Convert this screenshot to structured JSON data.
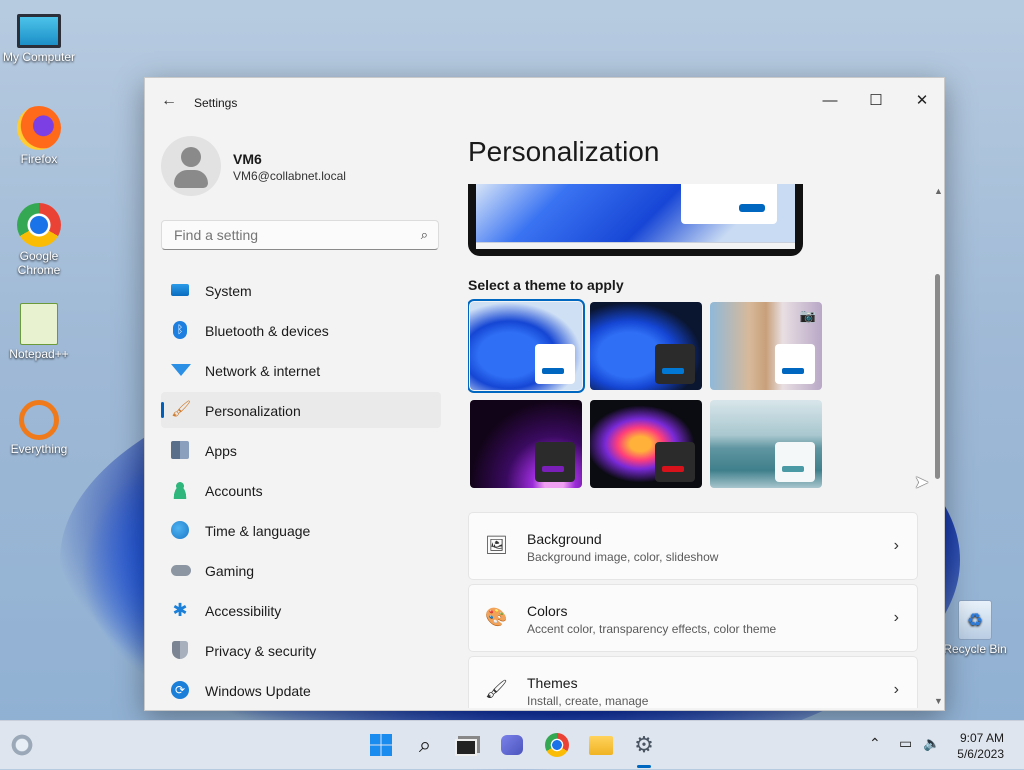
{
  "desktop": {
    "icons": [
      {
        "label": "My Computer"
      },
      {
        "label": "Firefox"
      },
      {
        "label": "Google Chrome"
      },
      {
        "label": "Notepad++"
      },
      {
        "label": "Everything"
      },
      {
        "label": "Recycle Bin"
      }
    ]
  },
  "window": {
    "title": "Settings",
    "controls": {
      "minimize": "—",
      "maximize": "☐",
      "close": "✕"
    },
    "back_icon": "←"
  },
  "profile": {
    "name": "VM6",
    "email": "VM6@collabnet.local"
  },
  "search": {
    "placeholder": "Find a setting"
  },
  "nav": {
    "items": [
      {
        "label": "System",
        "icon": "monitor-icon",
        "active": false
      },
      {
        "label": "Bluetooth & devices",
        "icon": "bluetooth-icon",
        "active": false
      },
      {
        "label": "Network & internet",
        "icon": "wifi-icon",
        "active": false
      },
      {
        "label": "Personalization",
        "icon": "paintbrush-icon",
        "active": true
      },
      {
        "label": "Apps",
        "icon": "apps-icon",
        "active": false
      },
      {
        "label": "Accounts",
        "icon": "person-icon",
        "active": false
      },
      {
        "label": "Time & language",
        "icon": "globe-clock-icon",
        "active": false
      },
      {
        "label": "Gaming",
        "icon": "gamepad-icon",
        "active": false
      },
      {
        "label": "Accessibility",
        "icon": "accessibility-icon",
        "active": false
      },
      {
        "label": "Privacy & security",
        "icon": "shield-icon",
        "active": false
      },
      {
        "label": "Windows Update",
        "icon": "update-icon",
        "active": false
      }
    ]
  },
  "main": {
    "title": "Personalization",
    "themes_label": "Select a theme to apply",
    "themes": [
      {
        "name": "windows-light",
        "selected": true
      },
      {
        "name": "windows-dark",
        "selected": false
      },
      {
        "name": "windows-spotlight",
        "selected": false
      },
      {
        "name": "glow",
        "selected": false
      },
      {
        "name": "captured-motion",
        "selected": false
      },
      {
        "name": "flow",
        "selected": false
      }
    ],
    "cards": [
      {
        "title": "Background",
        "subtitle": "Background image, color, slideshow",
        "icon": "image-icon"
      },
      {
        "title": "Colors",
        "subtitle": "Accent color, transparency effects, color theme",
        "icon": "palette-icon"
      },
      {
        "title": "Themes",
        "subtitle": "Install, create, manage",
        "icon": "brush-icon"
      }
    ]
  },
  "taskbar": {
    "time": "9:07 AM",
    "date": "5/6/2023"
  },
  "colors": {
    "accent": "#0067c0",
    "window_bg": "#f3f3f3"
  }
}
